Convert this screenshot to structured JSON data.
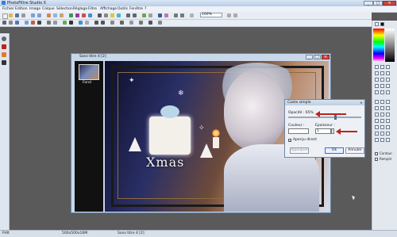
{
  "app": {
    "title": "PhotoFiltre Studio X"
  },
  "menu": [
    "Fichier",
    "Edition",
    "Image",
    "Calque",
    "Sélection",
    "Réglage",
    "Filtre",
    "Affichage",
    "Outils",
    "Fenêtre",
    "?"
  ],
  "toolbar": {
    "zoom": "100%"
  },
  "document": {
    "title": "Sans titre 4 [2]",
    "layer_label": "Fond",
    "image_text": "Xmas"
  },
  "dialog": {
    "title": "Cadre simple",
    "opacity_label": "Opacité : 65%",
    "opacity_value": 65,
    "color_label": "Couleur :",
    "thickness_label": "Epaisseur :",
    "thickness_value": "1",
    "preview_label": "Aperçu direct",
    "buttons": {
      "apply": "Appliquer",
      "ok": "Ok",
      "cancel": "Annuler"
    }
  },
  "right_panel": {
    "contour_label": "Contour",
    "fill_label": "Remplir"
  },
  "status": {
    "ready": "Prêt",
    "size": "500x500x16M",
    "doc": "Sans titre 4 [2]"
  },
  "colors": {
    "accent": "#3a7bd5",
    "arrow": "#c0211b",
    "workspace": "#5a5a5a"
  },
  "icons": [
    "app-icon",
    "minimize-icon",
    "maximize-icon",
    "close-icon",
    "arrow-pointer-icon",
    "palette-icon"
  ]
}
